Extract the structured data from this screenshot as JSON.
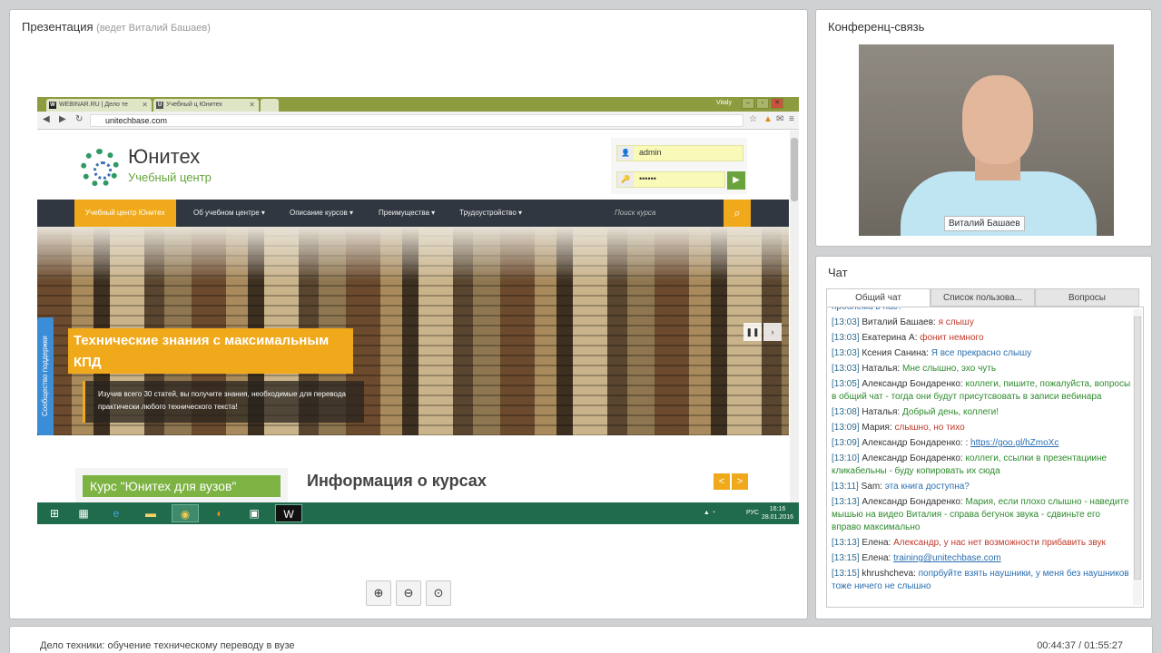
{
  "presentation": {
    "title": "Презентация",
    "subtitle": "(ведет Виталий Башаев)",
    "screen": {
      "browser_tabs": [
        "WEBINAR.RU | Дело те",
        "Учебный ц Юнитех"
      ],
      "window_user": "Vitaly",
      "url": "unitechbase.com",
      "site": {
        "logo_title": "Юнитех",
        "logo_subtitle": "Учебный центр",
        "login_user": "admin",
        "login_password": "••••••",
        "menu": [
          "Учебный центр Юнитех",
          "Об учебном центре ▾",
          "Описание курсов ▾",
          "Преимущества ▾",
          "Трудоустройство ▾"
        ],
        "search_placeholder": "Поиск курса",
        "support_tab": "Сообщество поддержки",
        "hero_title": "Технические знания с максимальным КПД",
        "hero_text": "Изучив всего 30 статей, вы получите знания, необходимые для перевода практически любого технического текста!",
        "course_badge": "Курс \"Юнитех для вузов\"",
        "info_heading": "Информация о курсах"
      },
      "taskbar": {
        "lang": "РУС",
        "time": "16:16",
        "date": "28.01.2016"
      }
    },
    "zoom_buttons": [
      "zoom-in",
      "zoom-out",
      "zoom-fit"
    ]
  },
  "conference": {
    "title": "Конференц-связь",
    "speaker_name": "Виталий Башаев"
  },
  "chat": {
    "title": "Чат",
    "tabs": [
      "Общий чат",
      "Список пользова...",
      "Вопросы"
    ],
    "messages": [
      {
        "time": "",
        "author": "",
        "text": "проблема в нас?",
        "color": "blue"
      },
      {
        "time": "[13:03]",
        "author": "Виталий Башаев:",
        "text": "я слышу",
        "color": "red"
      },
      {
        "time": "[13:03]",
        "author": "Екатерина А:",
        "text": "фонит немного",
        "color": "red"
      },
      {
        "time": "[13:03]",
        "author": "Ксения Санина:",
        "text": "Я все прекрасно слышу",
        "color": "blue"
      },
      {
        "time": "[13:03]",
        "author": "Наталья:",
        "text": "Мне слышно, эхо чуть",
        "color": "green"
      },
      {
        "time": "[13:05]",
        "author": "Александр Бондаренко:",
        "text": "коллеги, пишите, пожалуйста, вопросы в общий чат - тогда они будут присутсвовать в записи вебинара",
        "color": "green"
      },
      {
        "time": "[13:08]",
        "author": "Наталья:",
        "text": "Добрый день, коллеги!",
        "color": "green"
      },
      {
        "time": "[13:09]",
        "author": "Мария:",
        "text": "слышно, но тихо",
        "color": "red"
      },
      {
        "time": "[13:09]",
        "author": "Александр Бондаренко: :",
        "text": "https://goo.gl/hZmoXc",
        "color": "link"
      },
      {
        "time": "[13:10]",
        "author": "Александр Бондаренко:",
        "text": "коллеги, ссылки в презентациине кликабельны - буду копировать их сюда",
        "color": "green"
      },
      {
        "time": "[13:11]",
        "author": "Sam:",
        "text": "эта книга доступна?",
        "color": "blue"
      },
      {
        "time": "[13:13]",
        "author": "Александр Бондаренко:",
        "text": "Мария, если плохо слышно - наведите мышью на видео Виталия - справа бегунок звука - сдвиньте его вправо максимально",
        "color": "green"
      },
      {
        "time": "[13:13]",
        "author": "Елена:",
        "text": "Александр, у нас нет возможности прибавить звук",
        "color": "red"
      },
      {
        "time": "[13:15]",
        "author": "Елена:",
        "text": "training@unitechbase.com",
        "color": "link"
      },
      {
        "time": "[13:15]",
        "author": "khrushcheva:",
        "text": "попрбуйте взять наушники, у меня без наушников тоже ничего не слышно",
        "color": "blue"
      }
    ]
  },
  "footer": {
    "title": "Дело техники: обучение техническому переводу в вузе",
    "time": "00:44:37 / 01:55:27"
  },
  "colors": {
    "accent": "#f0a91a",
    "green": "#1f6b4c",
    "chat_time": "#2f6b8f"
  }
}
